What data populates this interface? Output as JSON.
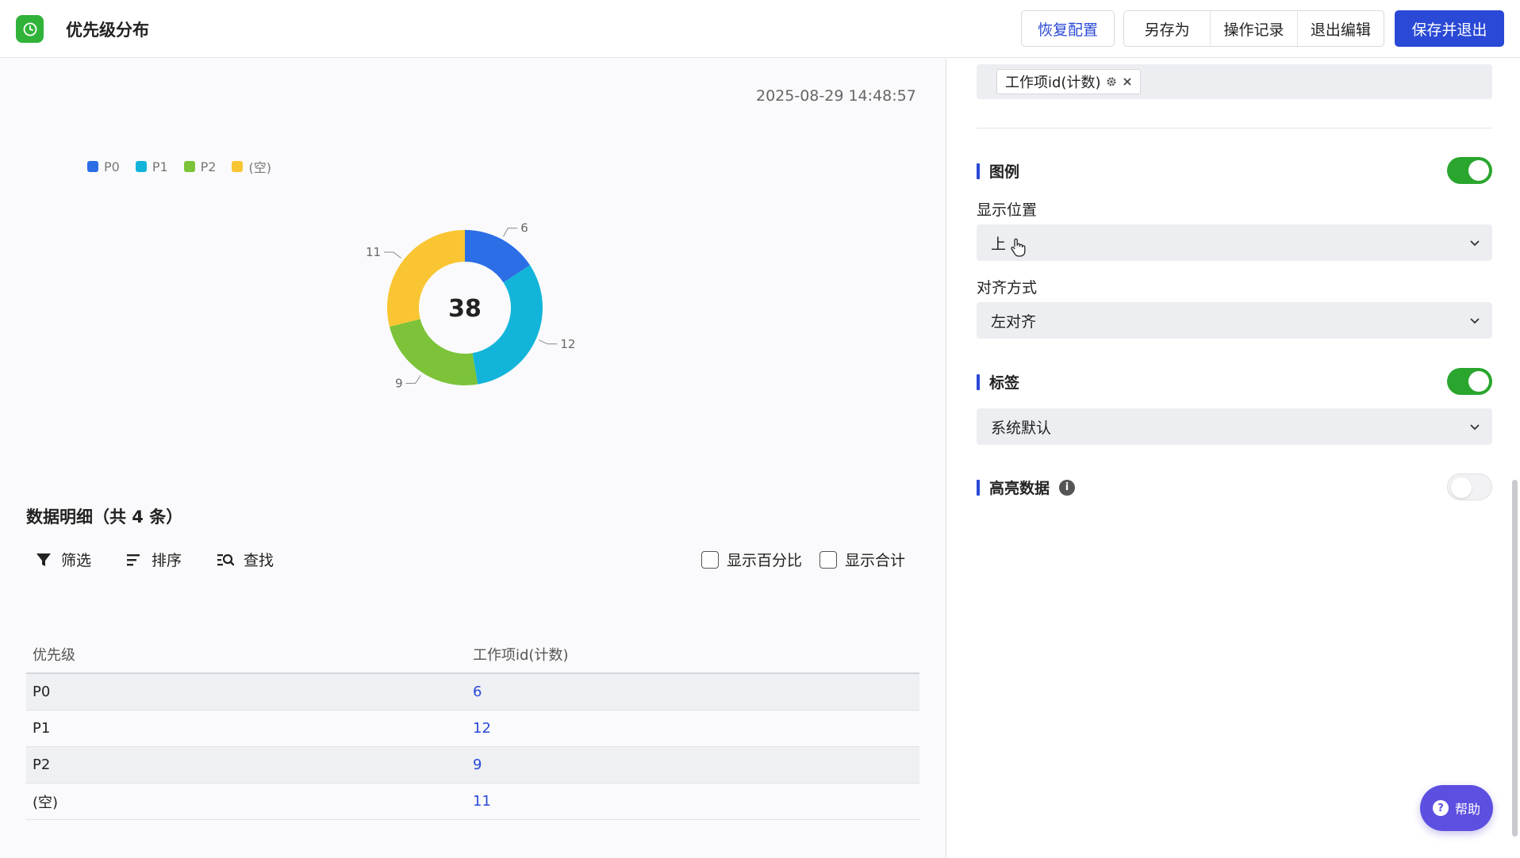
{
  "header": {
    "title": "优先级分布",
    "icon": "clock-icon",
    "buttons": {
      "restore": "恢复配置",
      "save_as": "另存为",
      "history": "操作记录",
      "exit_edit": "退出编辑",
      "save_exit": "保存并退出"
    }
  },
  "chart": {
    "timestamp": "2025-08-29 14:48:57",
    "center_total": "38"
  },
  "chart_data": {
    "type": "pie",
    "categories": [
      "P0",
      "P1",
      "P2",
      "(空)"
    ],
    "values": [
      6,
      12,
      9,
      11
    ],
    "colors": [
      "#2b6ee6",
      "#12b5d9",
      "#7cc33a",
      "#f9c532"
    ],
    "legend_position": "top-left",
    "center_label": "38"
  },
  "detail": {
    "title": "数据明细（共 4 条）",
    "tools": {
      "filter": "筛选",
      "sort": "排序",
      "find": "查找"
    },
    "checks": {
      "percent": "显示百分比",
      "total": "显示合计"
    },
    "columns": [
      "优先级",
      "工作项id(计数)"
    ],
    "rows": [
      {
        "k": "P0",
        "v": "6"
      },
      {
        "k": "P1",
        "v": "12"
      },
      {
        "k": "P2",
        "v": "9"
      },
      {
        "k": "(空)",
        "v": "11"
      }
    ]
  },
  "settings": {
    "field_chip": "工作项id(计数)",
    "legend": {
      "label": "图例",
      "on": true,
      "position_label": "显示位置",
      "position_value": "上",
      "align_label": "对齐方式",
      "align_value": "左对齐"
    },
    "tag": {
      "label": "标签",
      "on": true,
      "value": "系统默认"
    },
    "highlight": {
      "label": "高亮数据",
      "on": false
    }
  },
  "help": {
    "label": "帮助"
  }
}
